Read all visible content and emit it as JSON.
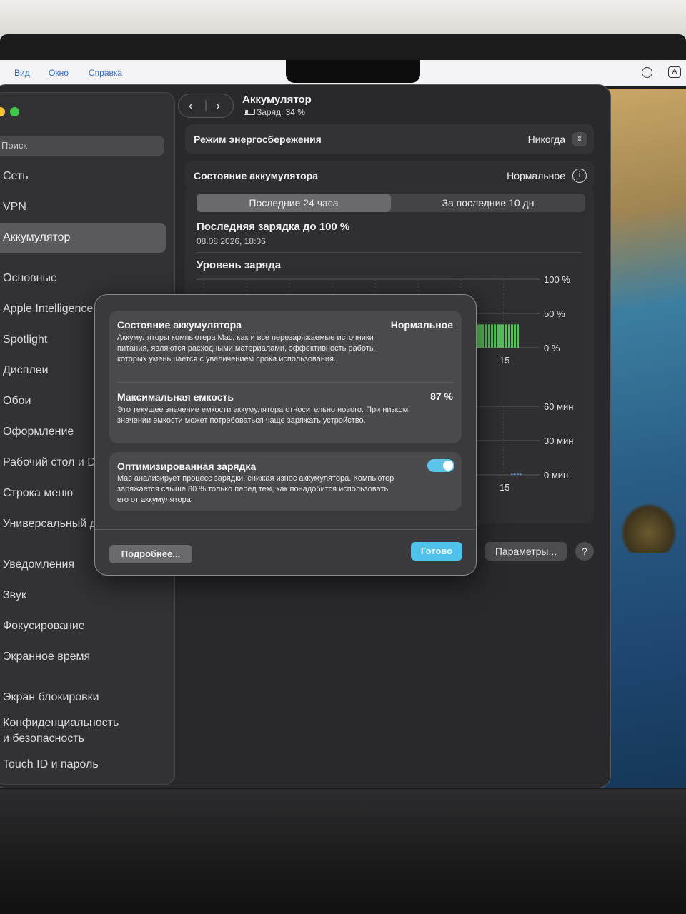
{
  "menubar": {
    "items": [
      "Вид",
      "Окно",
      "Справка"
    ],
    "right_badge": "A"
  },
  "sidebar": {
    "search_label": "Поиск",
    "items": [
      "Сеть",
      "VPN",
      "Аккумулятор",
      "Основные",
      "Apple Intelligence",
      "Spotlight",
      "Дисплеи",
      "Обои",
      "Оформление",
      "Рабочий стол и Dock",
      "Строка меню",
      "Универсальный доступ",
      "Уведомления",
      "Звук",
      "Фокусирование",
      "Экранное время",
      "Экран блокировки",
      "Конфиденциальность",
      "и безопасность",
      "Touch ID и пароль"
    ],
    "selected": "Аккумулятор"
  },
  "header": {
    "title": "Аккумулятор",
    "subtitle": "Заряд: 34 %"
  },
  "settings": {
    "low_power_label": "Режим энергосбережения",
    "low_power_value": "Никогда",
    "health_label": "Состояние аккумулятора",
    "health_value": "Нормальное"
  },
  "history": {
    "tabs": [
      "Последние 24 часа",
      "За последние 10 дн"
    ],
    "selected_tab": "Последние 24 часа",
    "last_charge_title": "Последняя зарядка до 100 %",
    "last_charge_date": "08.08.2026, 18:06",
    "level_title": "Уровень заряда"
  },
  "chart_data": [
    {
      "type": "bar",
      "title": "Уровень заряда",
      "ytick_labels": [
        "100 %",
        "50 %",
        "0 %"
      ],
      "ylim": [
        0,
        100
      ],
      "xtick_labels": [
        "15"
      ],
      "color": "#37d63a"
    },
    {
      "type": "bar",
      "ytick_labels": [
        "60 мин",
        "30 мин",
        "0 мин"
      ],
      "ylim": [
        0,
        60
      ],
      "xtick_labels": [
        "15"
      ],
      "color": "#4a90e2"
    }
  ],
  "footer": {
    "options_label": "Параметры...",
    "help_label": "?"
  },
  "modal": {
    "health_title": "Состояние аккумулятора",
    "health_value": "Нормальное",
    "health_desc": "Аккумуляторы компьютера Mac, как и все перезаряжаемые источники питания, являются расходными материалами, эффективность работы которых уменьшается с увеличением срока использования.",
    "capacity_title": "Максимальная емкость",
    "capacity_value": "87 %",
    "capacity_desc": "Это текущее значение емкости аккумулятора относительно нового. При низком значении емкости может потребоваться чаще заряжать устройство.",
    "optimized_title": "Оптимизированная зарядка",
    "optimized_desc": "Mac анализирует процесс зарядки, снижая износ аккумулятора. Компьютер заряжается свыше 80 % только перед тем, как понадобится использовать его от аккумулятора.",
    "optimized_enabled": true,
    "more_label": "Подробнее...",
    "done_label": "Готово"
  }
}
